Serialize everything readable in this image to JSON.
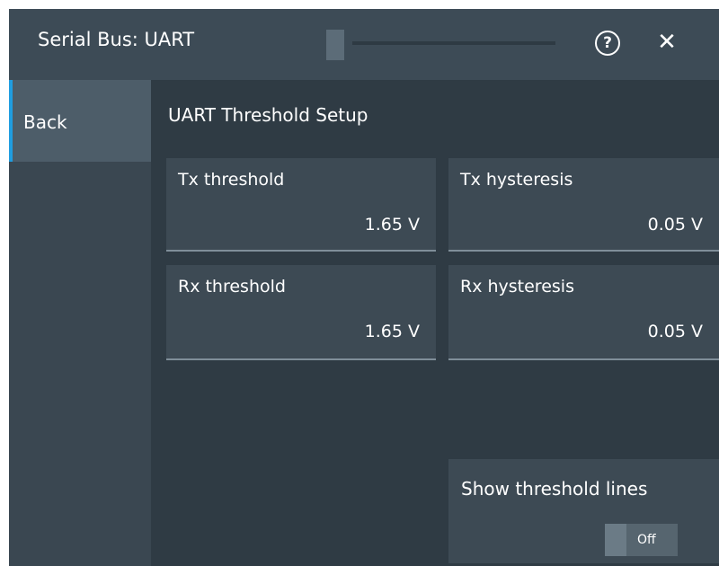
{
  "header": {
    "title": "Serial Bus: UART",
    "help_icon": "?",
    "close_icon": "✕"
  },
  "sidebar": {
    "back_label": "Back"
  },
  "main": {
    "section_title": "UART Threshold Setup",
    "fields": [
      {
        "label": "Tx threshold",
        "value": "1.65 V"
      },
      {
        "label": "Tx hysteresis",
        "value": "0.05 V"
      },
      {
        "label": "Rx threshold",
        "value": "1.65 V"
      },
      {
        "label": "Rx hysteresis",
        "value": "0.05 V"
      }
    ],
    "show_threshold_lines": {
      "label": "Show threshold lines",
      "state": "Off"
    }
  },
  "colors": {
    "accent": "#1f9de0",
    "background": "#2f3b44",
    "panel": "#3d4a54"
  }
}
